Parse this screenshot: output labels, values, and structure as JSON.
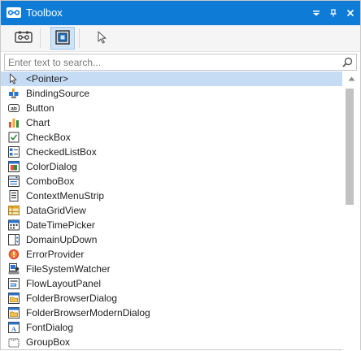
{
  "window": {
    "title": "Toolbox",
    "icon": "toolbox-icon",
    "title_buttons": [
      "dropdown-menu-icon",
      "pin-icon",
      "close-icon"
    ]
  },
  "toolbar": {
    "buttons": [
      {
        "icon": "component-icon",
        "active": false
      },
      {
        "icon": "form-layout-icon",
        "active": true
      },
      {
        "icon": "pointer-icon",
        "active": false
      }
    ]
  },
  "search": {
    "placeholder": "Enter text to search...",
    "value": "",
    "button_icon": "search-icon"
  },
  "items": [
    {
      "label": "<Pointer>",
      "icon": "pointer-icon",
      "selected": true
    },
    {
      "label": "BindingSource",
      "icon": "bindingsource-icon"
    },
    {
      "label": "Button",
      "icon": "button-icon"
    },
    {
      "label": "Chart",
      "icon": "chart-icon"
    },
    {
      "label": "CheckBox",
      "icon": "checkbox-icon"
    },
    {
      "label": "CheckedListBox",
      "icon": "checkedlistbox-icon"
    },
    {
      "label": "ColorDialog",
      "icon": "colordialog-icon"
    },
    {
      "label": "ComboBox",
      "icon": "combobox-icon"
    },
    {
      "label": "ContextMenuStrip",
      "icon": "contextmenustrip-icon"
    },
    {
      "label": "DataGridView",
      "icon": "datagridview-icon"
    },
    {
      "label": "DateTimePicker",
      "icon": "datetimepicker-icon"
    },
    {
      "label": "DomainUpDown",
      "icon": "domainupdown-icon"
    },
    {
      "label": "ErrorProvider",
      "icon": "errorprovider-icon"
    },
    {
      "label": "FileSystemWatcher",
      "icon": "filesystemwatcher-icon"
    },
    {
      "label": "FlowLayoutPanel",
      "icon": "flowlayoutpanel-icon"
    },
    {
      "label": "FolderBrowserDialog",
      "icon": "folderbrowserdialog-icon"
    },
    {
      "label": "FolderBrowserModernDialog",
      "icon": "folderbrowsermoderndialog-icon"
    },
    {
      "label": "FontDialog",
      "icon": "fontdialog-icon"
    },
    {
      "label": "GroupBox",
      "icon": "groupbox-icon"
    }
  ],
  "colors": {
    "titlebar": "#0e7bd6",
    "selection": "#c6dcf4",
    "accent": "#1a6fc6"
  }
}
